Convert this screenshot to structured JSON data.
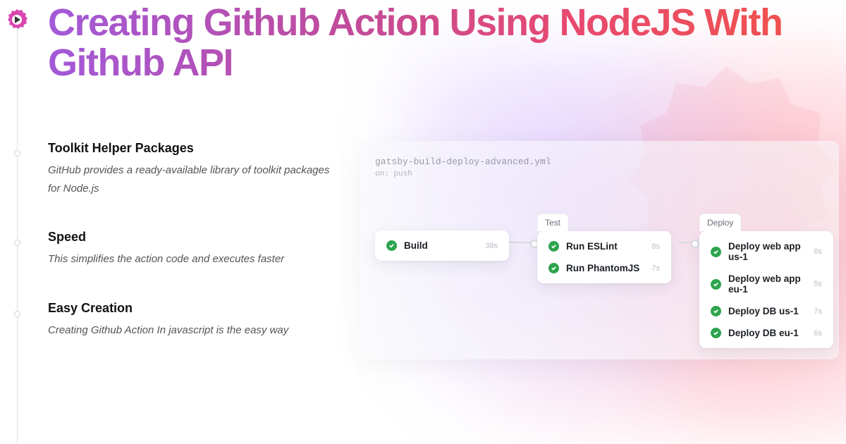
{
  "title": "Creating Github Action Using NodeJS With Github API",
  "features": [
    {
      "heading": "Toolkit Helper Packages",
      "desc": "GitHub provides a ready-available library of toolkit packages for Node.js"
    },
    {
      "heading": "Speed",
      "desc": "This simplifies the action code and executes faster"
    },
    {
      "heading": "Easy Creation",
      "desc": "Creating Github Action In javascript is the easy way"
    }
  ],
  "workflow": {
    "filename": "gatsby-build-deploy-advanced.yml",
    "trigger": "on: push",
    "build": {
      "label": "Build",
      "steps": [
        {
          "name": "Build",
          "dur": "38s"
        }
      ]
    },
    "test": {
      "label": "Test",
      "steps": [
        {
          "name": "Run ESLint",
          "dur": "8s"
        },
        {
          "name": "Run PhantomJS",
          "dur": "7s"
        }
      ]
    },
    "deploy": {
      "label": "Deploy",
      "steps": [
        {
          "name": "Deploy web app us-1",
          "dur": "6s"
        },
        {
          "name": "Deploy web app eu-1",
          "dur": "5s"
        },
        {
          "name": "Deploy DB us-1",
          "dur": "7s"
        },
        {
          "name": "Deploy DB eu-1",
          "dur": "6s"
        }
      ]
    }
  }
}
